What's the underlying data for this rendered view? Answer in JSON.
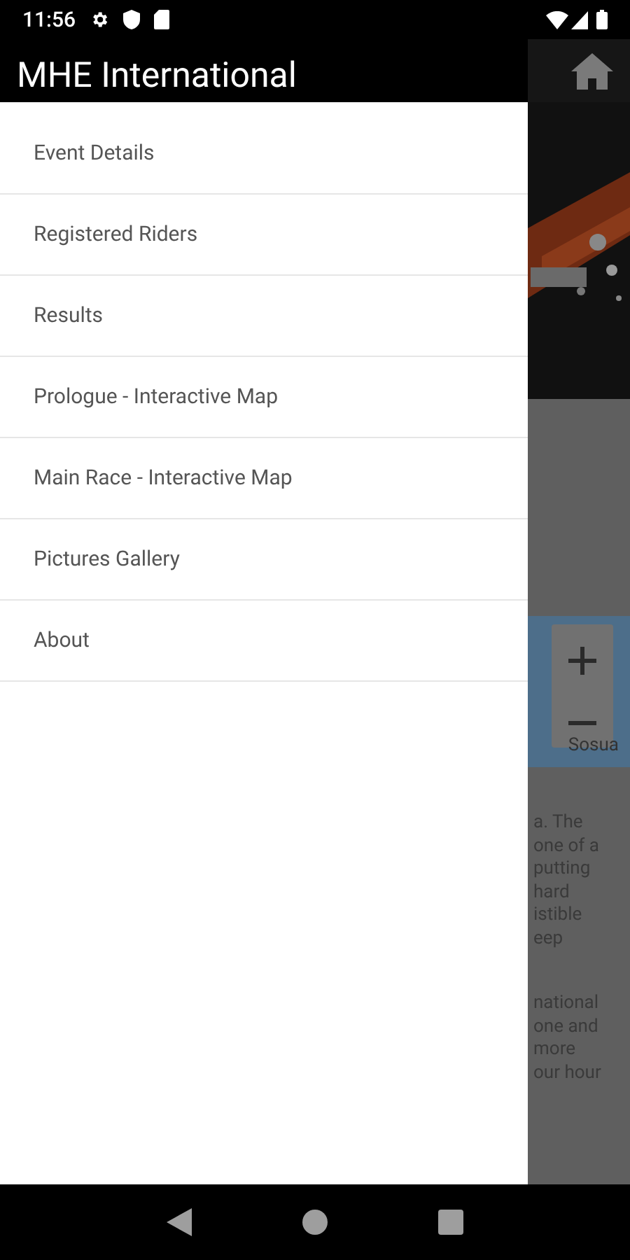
{
  "status_bar": {
    "time": "11:56"
  },
  "drawer": {
    "title": "MHE International",
    "items": [
      {
        "label": "Event Details"
      },
      {
        "label": "Registered Riders"
      },
      {
        "label": "Results"
      },
      {
        "label": "Prologue - Interactive Map"
      },
      {
        "label": "Main Race - Interactive Map"
      },
      {
        "label": "Pictures Gallery"
      },
      {
        "label": "About"
      }
    ]
  },
  "background": {
    "map_label": "Sosua",
    "paragraphs": [
      [
        "a. The",
        "one of a",
        "putting",
        "hard",
        "istible",
        "eep"
      ],
      [
        "national",
        "one and",
        "more",
        "our hour"
      ]
    ]
  }
}
